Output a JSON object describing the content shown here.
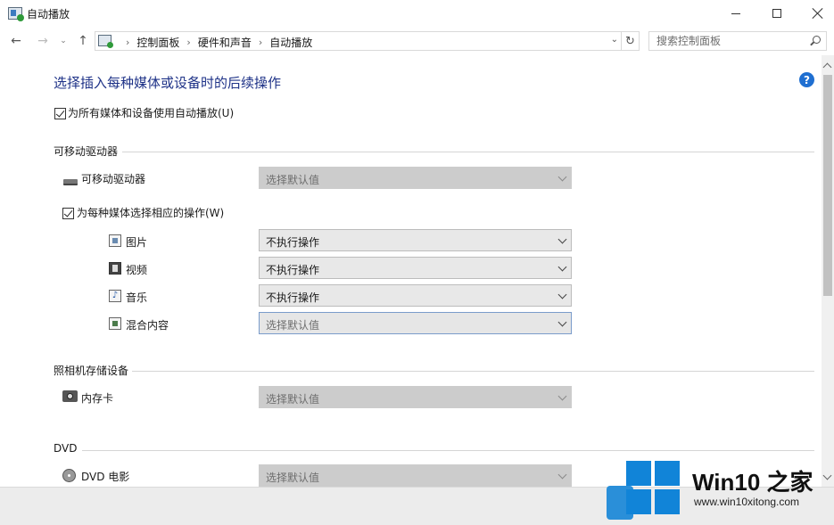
{
  "window": {
    "title": "自动播放"
  },
  "nav": {
    "breadcrumbs": [
      "控制面板",
      "硬件和声音",
      "自动播放"
    ],
    "search_placeholder": "搜索控制面板"
  },
  "page": {
    "heading": "选择插入每种媒体或设备时的后续操作",
    "use_autoplay_label": "为所有媒体和设备使用自动播放(U)",
    "use_autoplay_checked": true
  },
  "sections": {
    "removable": {
      "title": "可移动驱动器",
      "drive_label": "可移动驱动器",
      "drive_value": "选择默认值",
      "per_media_label": "为每种媒体选择相应的操作(W)",
      "per_media_checked": true,
      "items": [
        {
          "label": "图片",
          "value": "不执行操作",
          "icon": "picture-icon"
        },
        {
          "label": "视频",
          "value": "不执行操作",
          "icon": "video-icon"
        },
        {
          "label": "音乐",
          "value": "不执行操作",
          "icon": "music-icon"
        },
        {
          "label": "混合内容",
          "value": "选择默认值",
          "icon": "mixed-content-icon"
        }
      ]
    },
    "camera": {
      "title": "照相机存储设备",
      "memory_card_label": "内存卡",
      "memory_card_value": "选择默认值"
    },
    "dvd": {
      "title": "DVD",
      "movie_label": "DVD 电影",
      "movie_value": "选择默认值"
    }
  },
  "watermark": {
    "title": "Win10 之家",
    "url": "www.win10xitong.com"
  }
}
